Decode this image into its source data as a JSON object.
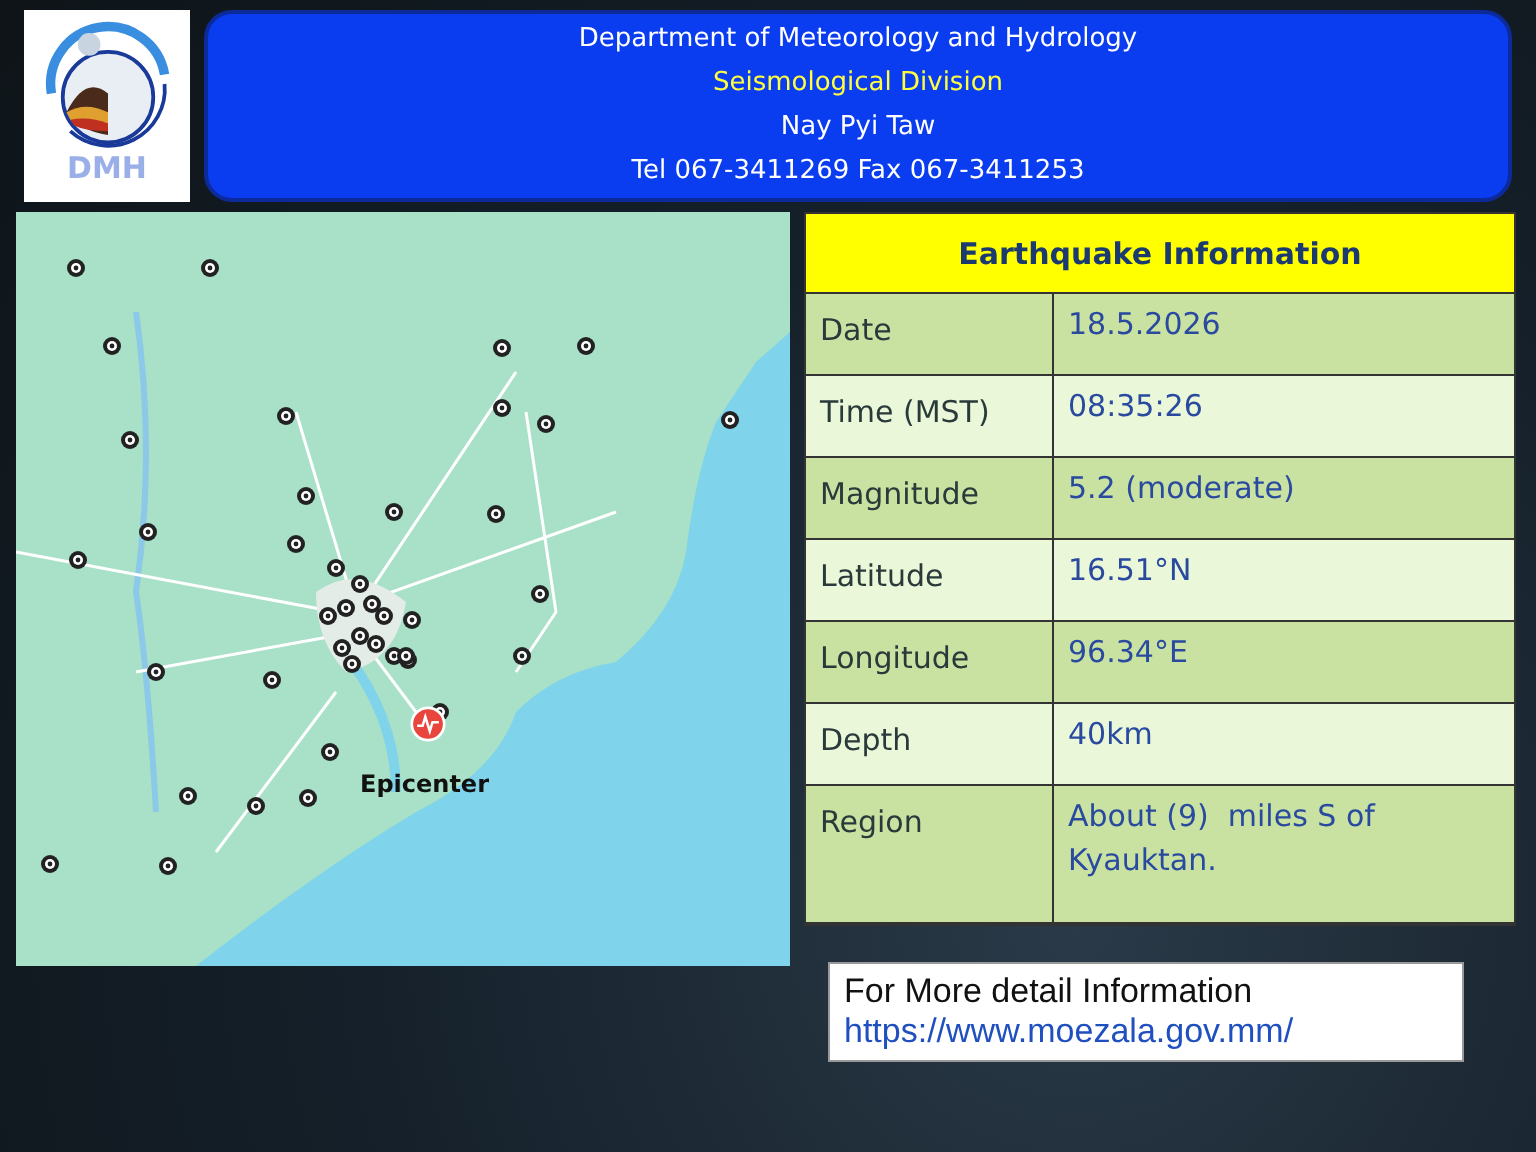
{
  "header": {
    "lines": [
      {
        "text": "Department of Meteorology and Hydrology",
        "kind": "title"
      },
      {
        "text": "Seismological Division",
        "kind": "highlight"
      },
      {
        "text": "Nay Pyi Taw",
        "kind": "plain"
      },
      {
        "text": "Tel 067-3411269 Fax 067-3411253",
        "kind": "plain"
      }
    ],
    "logo_text": "DMH"
  },
  "map": {
    "epicenter_label": "Epicenter"
  },
  "info_table": {
    "title": "Earthquake Information",
    "rows": [
      {
        "label": "Date",
        "value": "18.5.2026"
      },
      {
        "label": "Time (MST)",
        "value": "08:35:26"
      },
      {
        "label": "Magnitude",
        "value": "5.2 (moderate)"
      },
      {
        "label": "Latitude",
        "value": "16.51°N"
      },
      {
        "label": "Longitude",
        "value": "96.34°E"
      },
      {
        "label": "Depth",
        "value": "40km"
      },
      {
        "label": "Region",
        "value": "About (9)  miles S of Kyauktan."
      }
    ]
  },
  "more_info": {
    "text": "For More detail Information",
    "link": "https://www.moezala.gov.mm/"
  }
}
